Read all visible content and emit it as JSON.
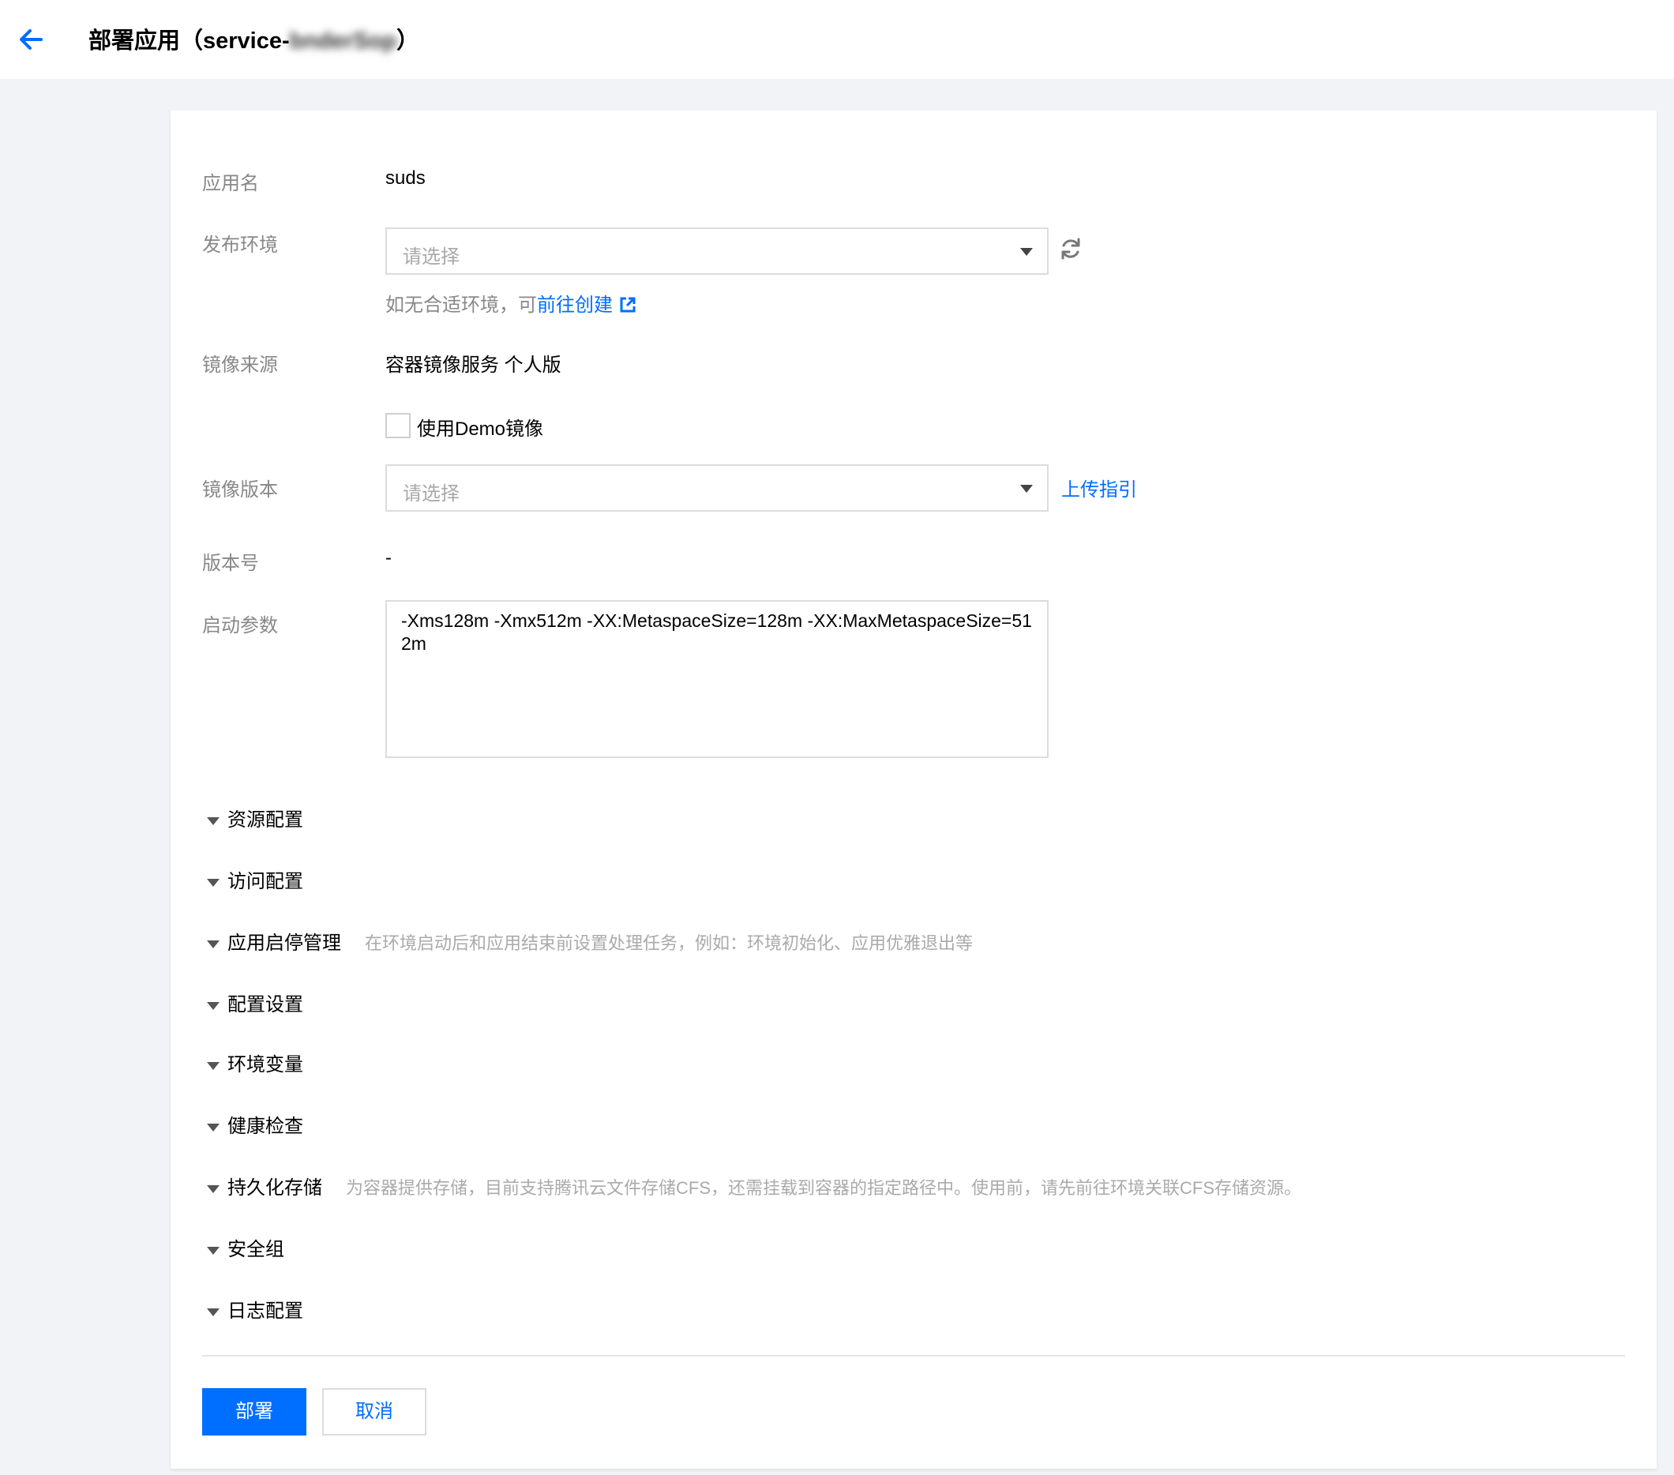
{
  "header": {
    "title_prefix": "部署应用（service-",
    "title_blurred": "bnderSop",
    "title_suffix": "）"
  },
  "form": {
    "app_name_label": "应用名",
    "app_name_value": "suds",
    "env_label": "发布环境",
    "env_placeholder": "请选择",
    "env_hint": "如无合适环境，可",
    "env_hint_link": "前往创建",
    "image_source_label": "镜像来源",
    "image_source_value": "容器镜像服务 个人版",
    "demo_image_label": "使用Demo镜像",
    "demo_image_checked": false,
    "image_version_label": "镜像版本",
    "image_version_placeholder": "请选择",
    "upload_guide_link": "上传指引",
    "version_no_label": "版本号",
    "version_no_value": "-",
    "startup_params_label": "启动参数",
    "startup_params_value": "-Xms128m -Xmx512m -XX:MetaspaceSize=128m -XX:MaxMetaspaceSize=512m"
  },
  "sections": [
    {
      "title": "资源配置",
      "desc": ""
    },
    {
      "title": "访问配置",
      "desc": ""
    },
    {
      "title": "应用启停管理",
      "desc": "在环境启动后和应用结束前设置处理任务，例如：环境初始化、应用优雅退出等"
    },
    {
      "title": "配置设置",
      "desc": ""
    },
    {
      "title": "环境变量",
      "desc": ""
    },
    {
      "title": "健康检查",
      "desc": ""
    },
    {
      "title": "持久化存储",
      "desc": "为容器提供存储，目前支持腾讯云文件存储CFS，还需挂载到容器的指定路径中。使用前，请先前往环境关联CFS存储资源。"
    },
    {
      "title": "安全组",
      "desc": ""
    },
    {
      "title": "日志配置",
      "desc": ""
    }
  ],
  "actions": {
    "deploy_label": "部署",
    "cancel_label": "取消"
  },
  "colors": {
    "primary": "#006eff",
    "page_bg": "#f2f3f7"
  }
}
